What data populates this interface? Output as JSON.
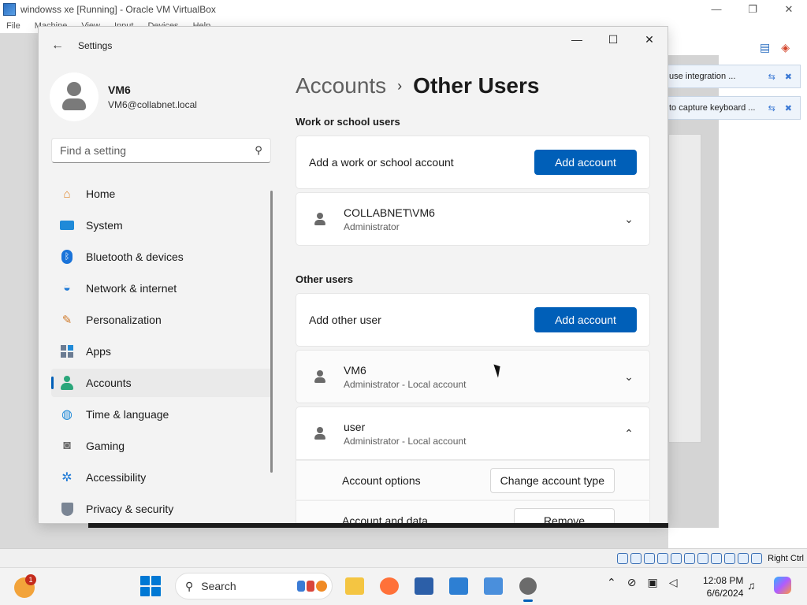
{
  "vbox": {
    "title": "windowss xe [Running] - Oracle VM VirtualBox",
    "menu": [
      "File",
      "Machine",
      "View",
      "Input",
      "Devices",
      "Help"
    ],
    "window_controls": {
      "minimize": "—",
      "restore": "❐",
      "close": "✕"
    },
    "notices": [
      {
        "text": "use integration ..."
      },
      {
        "text": "to capture keyboard ..."
      }
    ],
    "host_key": "Right Ctrl"
  },
  "settings": {
    "app_title": "Settings",
    "back_icon": "←",
    "window_controls": {
      "minimize": "—",
      "maximize": "☐",
      "close": "✕"
    },
    "profile": {
      "name": "VM6",
      "email": "VM6@collabnet.local"
    },
    "search": {
      "placeholder": "Find a setting",
      "icon": "⚲"
    },
    "nav": [
      {
        "label": "Home",
        "icon": "home-icon"
      },
      {
        "label": "System",
        "icon": "system-icon"
      },
      {
        "label": "Bluetooth & devices",
        "icon": "bluetooth-icon"
      },
      {
        "label": "Network & internet",
        "icon": "wifi-icon"
      },
      {
        "label": "Personalization",
        "icon": "brush-icon"
      },
      {
        "label": "Apps",
        "icon": "apps-icon"
      },
      {
        "label": "Accounts",
        "icon": "accounts-icon",
        "active": true
      },
      {
        "label": "Time & language",
        "icon": "globe-icon"
      },
      {
        "label": "Gaming",
        "icon": "gamepad-icon"
      },
      {
        "label": "Accessibility",
        "icon": "accessibility-icon"
      },
      {
        "label": "Privacy & security",
        "icon": "shield-icon"
      }
    ],
    "breadcrumb": {
      "parent": "Accounts",
      "separator": "›",
      "current": "Other Users"
    },
    "work_section": {
      "heading": "Work or school users",
      "add_label": "Add a work or school account",
      "add_button": "Add account",
      "users": [
        {
          "name": "COLLABNET\\VM6",
          "role": "Administrator",
          "expanded": false
        }
      ]
    },
    "other_section": {
      "heading": "Other users",
      "add_label": "Add other user",
      "add_button": "Add account",
      "users": [
        {
          "name": "VM6",
          "role": "Administrator - Local account",
          "expanded": false
        },
        {
          "name": "user",
          "role": "Administrator - Local account",
          "expanded": true
        }
      ],
      "expanded_options": {
        "account_options_label": "Account options",
        "account_options_button": "Change account type",
        "account_data_label": "Account and data",
        "account_data_button": "Remove"
      }
    }
  },
  "taskbar": {
    "weather_badge": "1",
    "search_label": "Search",
    "clock": {
      "time": "12:08 PM",
      "date": "6/6/2024"
    }
  },
  "colors": {
    "accent": "#005fb8",
    "start": "#0078d4"
  }
}
